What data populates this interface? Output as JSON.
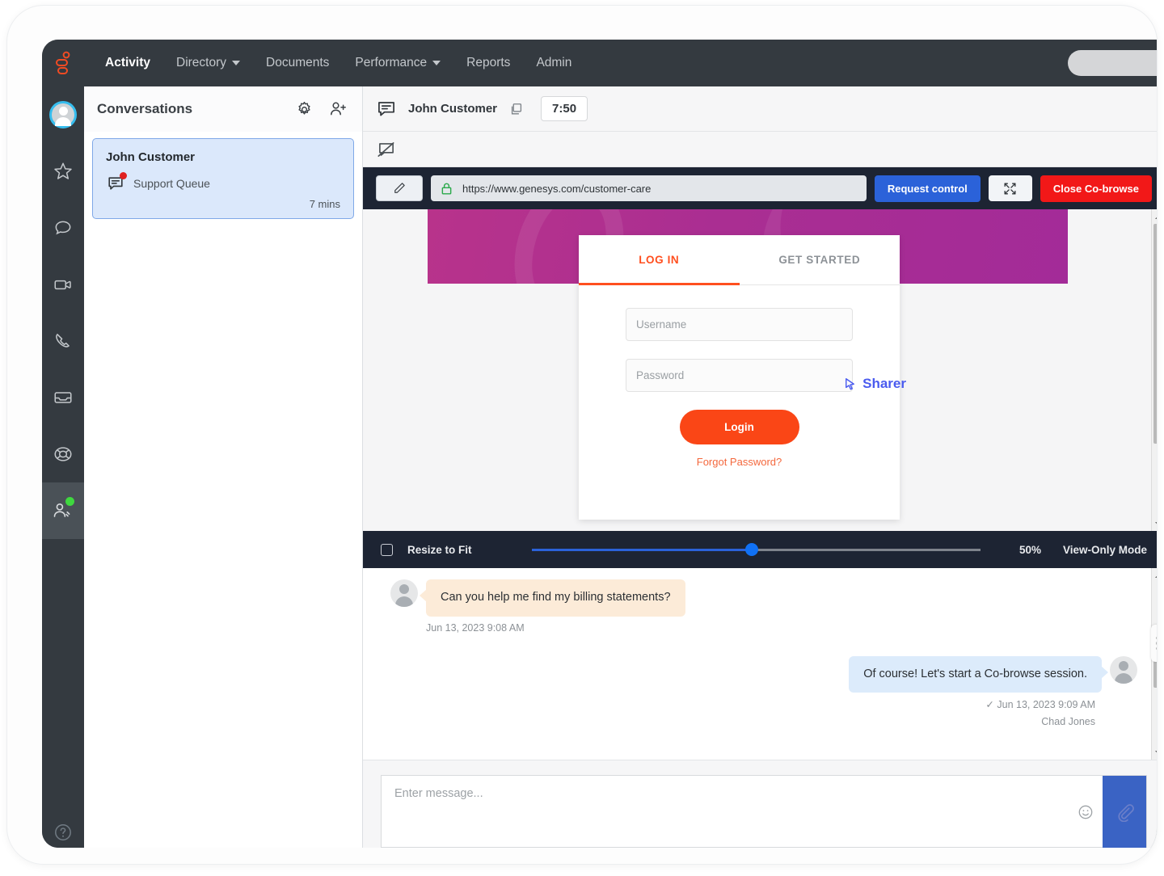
{
  "topnav": {
    "logo": "genesys-logo",
    "items": [
      {
        "label": "Activity",
        "active": true,
        "caret": false
      },
      {
        "label": "Directory",
        "active": false,
        "caret": true
      },
      {
        "label": "Documents",
        "active": false,
        "caret": false
      },
      {
        "label": "Performance",
        "active": false,
        "caret": true
      },
      {
        "label": "Reports",
        "active": false,
        "caret": false
      },
      {
        "label": "Admin",
        "active": false,
        "caret": false
      }
    ]
  },
  "rail": {
    "items": [
      {
        "icon": "user-avatar-icon",
        "selected": false,
        "badge": false
      },
      {
        "icon": "star-icon",
        "selected": false,
        "badge": false
      },
      {
        "icon": "chat-bubble-icon",
        "selected": false,
        "badge": false
      },
      {
        "icon": "video-camera-icon",
        "selected": false,
        "badge": false
      },
      {
        "icon": "phone-icon",
        "selected": false,
        "badge": false
      },
      {
        "icon": "inbox-icon",
        "selected": false,
        "badge": false
      },
      {
        "icon": "lifebuoy-icon",
        "selected": false,
        "badge": false
      },
      {
        "icon": "people-agent-icon",
        "selected": true,
        "badge": true
      }
    ],
    "help_icon": "help-circle-icon"
  },
  "conversations": {
    "title": "Conversations",
    "settings_icon": "gear-icon",
    "add_icon": "add-person-icon",
    "items": [
      {
        "name": "John Customer",
        "queue": "Support Queue",
        "time": "7 mins",
        "icon": "chat-message-icon",
        "unread": true,
        "selected": true
      }
    ]
  },
  "interaction": {
    "header": {
      "channel_icon": "chat-message-icon",
      "customer": "John Customer",
      "copy_icon": "copy-icon",
      "timer": "7:50"
    },
    "subtoolbar": {
      "cobrowse_off_icon": "cobrowse-disabled-icon"
    }
  },
  "cobrowse": {
    "toolbar": {
      "draw_icon": "pencil-icon",
      "lock_icon": "lock-secure-icon",
      "url": "https://www.genesys.com/customer-care",
      "request_control_label": "Request control",
      "expand_icon": "expand-arrows-icon",
      "close_label": "Close Co-browse"
    },
    "page": {
      "tabs": [
        {
          "label": "LOG IN",
          "active": true
        },
        {
          "label": "GET STARTED",
          "active": false
        }
      ],
      "username_placeholder": "Username",
      "password_placeholder": "Password",
      "login_button": "Login",
      "forgot_link": "Forgot Password?",
      "sharer_label": "Sharer",
      "sharer_cursor_icon": "mouse-pointer-icon",
      "banner_color": "#aa2e92",
      "accent_color": "#fa4616"
    },
    "controls": {
      "resize_to_fit_label": "Resize to Fit",
      "resize_to_fit_checked": false,
      "zoom_percent": "50%",
      "zoom_value": 50,
      "mode_label": "View-Only Mode"
    },
    "scroll_icons": {
      "up": "scroll-up-arrow-icon",
      "down": "scroll-down-arrow-icon",
      "handle": "resize-drag-handle-icon"
    }
  },
  "chat": {
    "messages": [
      {
        "direction": "in",
        "text": "Can you help me find my billing statements?",
        "meta": "Jun 13, 2023 9:08 AM",
        "avatar_icon": "customer-avatar-icon"
      },
      {
        "direction": "out",
        "text": "Of course! Let's start a Co-browse session.",
        "meta": "✓ Jun 13, 2023 9:09 AM",
        "author": "Chad Jones",
        "avatar_icon": "agent-avatar-icon"
      }
    ]
  },
  "composer": {
    "placeholder": "Enter message...",
    "emoji_icon": "smiley-icon",
    "attach_icon": "paperclip-icon",
    "attach_color": "#3a63c4"
  },
  "colors": {
    "nav_dark": "#343a40",
    "cobrowse_dark": "#1d2433",
    "primary_blue": "#2b62d9",
    "danger_red": "#f21818",
    "genesys_orange": "#fa4616"
  }
}
